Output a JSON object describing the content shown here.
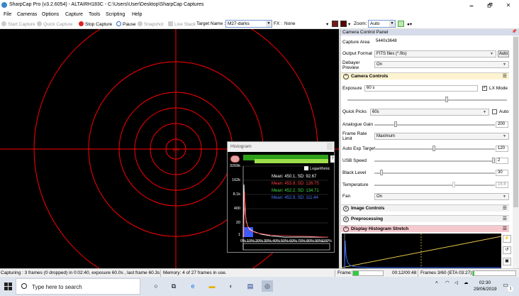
{
  "window": {
    "title": "SharpCap Pro (v3.2.6054) - ALTAIRH183C - C:\\Users\\User\\Desktop\\SharpCap Captures",
    "controls": [
      "🗕",
      "🗗",
      "✕"
    ]
  },
  "menu": [
    "File",
    "Cameras",
    "Options",
    "Capture",
    "Tools",
    "Scripting",
    "Help"
  ],
  "toolbar": {
    "start_capture": "Start Capture",
    "quick_capture": "Quick Capture",
    "stop_capture": "Stop Capture",
    "pause": "Pause",
    "snapshot": "Snapshot",
    "live_stack": "Live Stack",
    "target_label": "Target Name :",
    "target_value": "M27-darks",
    "fx_label": "FX :",
    "fx_value": "None",
    "zoom_label": "Zoom:",
    "zoom_value": "Auto",
    "reticle_color": "#ff0000"
  },
  "viewport": {
    "center_label": "0.0"
  },
  "histogram": {
    "title": "Histogram",
    "logarithmic_label": "Logarithmic",
    "stats": [
      {
        "text": "Mean: 450.1, SD: 92.67",
        "color": "#ffffff"
      },
      {
        "text": "Mean: 453.8, SD: 126.75",
        "color": "#ff4040"
      },
      {
        "text": "Mean: 452.2, SD: 134.71",
        "color": "#44dd44"
      },
      {
        "text": "Mean: 452.9, SD: 111.44",
        "color": "#4a7bff"
      }
    ],
    "y_ticks": [
      "3269k",
      "162k",
      "8.1k",
      "400",
      "20",
      "1"
    ],
    "x_ticks": [
      "0%",
      "10%",
      "20%",
      "30%",
      "40%",
      "50%",
      "60%",
      "70%",
      "80%",
      "90%",
      "100%"
    ]
  },
  "panel": {
    "title": "Camera Control Panel",
    "capture_area_label": "Capture Area",
    "capture_area_value": "5440x3648",
    "output_format_label": "Output Format",
    "output_format_value": "FITS files (*.fits)",
    "auto_btn": "Auto",
    "debayer_label": "Debayer Preview",
    "debayer_value": "On",
    "sections": {
      "camera_controls": "Camera Controls",
      "image_controls": "Image Controls",
      "preprocessing": "Preprocessing",
      "display_stretch": "Display Histogram Stretch"
    },
    "exposure_label": "Exposure",
    "exposure_value": "60 s",
    "lx_mode_label": "LX Mode",
    "quick_picks_label": "Quick Picks",
    "quick_picks_value": "60s",
    "auto_label": "Auto",
    "analogue_gain_label": "Analogue Gain",
    "analogue_gain_value": "200",
    "frame_rate_label": "Frame Rate Limit",
    "frame_rate_value": "Maximum",
    "auto_exp_target_label": "Auto Exp Target",
    "auto_exp_target_value": "120",
    "usb_speed_label": "USB Speed",
    "usb_speed_value": "2",
    "black_level_label": "Black Level",
    "black_level_value": "30",
    "temperature_label": "Temperature",
    "temperature_value": "16.6",
    "fan_label": "Fan",
    "fan_value": "On"
  },
  "status": {
    "capturing": "Capturing : 3 frames (0 dropped) in 0:02:40, exposure 60.0s , last frame 60.3s",
    "memory": "Memory: 4 of 27 frames in use.",
    "frame_label": "Frame:",
    "frame_progress": 0.2,
    "elapsed": "00:12/00:48",
    "frames_eta": "Frames 3/60 (ETA 03:27)"
  },
  "taskbar": {
    "search_placeholder": "Type here to search",
    "time": "02:30",
    "date": "29/06/2019",
    "notification_count": "1"
  }
}
